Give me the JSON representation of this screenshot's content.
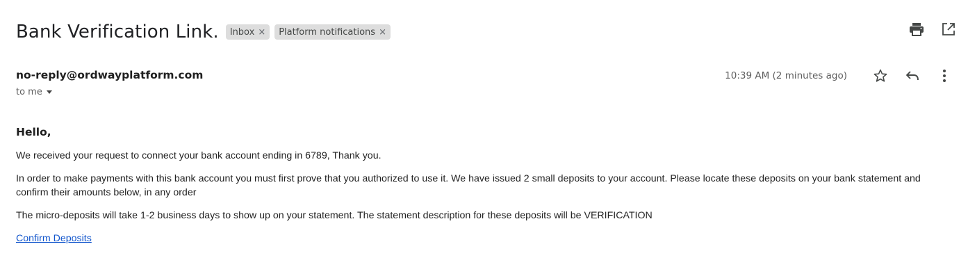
{
  "email": {
    "subject": "Bank Verification Link.",
    "labels": [
      {
        "name": "Inbox",
        "remove": "×"
      },
      {
        "name": "Platform notifications",
        "remove": "×"
      }
    ],
    "sender": "no-reply@ordwayplatform.com",
    "recipient": "to me",
    "timestamp": "10:39 AM (2 minutes ago)"
  },
  "icons": {
    "print": "print-icon",
    "open_new_window": "open-in-new-window-icon",
    "star": "star-icon",
    "reply": "reply-icon",
    "more": "more-vertical-icon",
    "recipient_caret": "caret-down-icon"
  },
  "body": {
    "greeting": "Hello,",
    "paragraphs": [
      "We received your request to connect your bank account ending in 6789, Thank you.",
      "In order to make payments with this bank account you must first prove that you authorized to use it. We have issued 2 small deposits to your account. Please locate these deposits on your bank statement and confirm their amounts below, in any order",
      "The micro-deposits will take 1-2 business days to show up on your statement. The statement description for these deposits will be VERIFICATION"
    ],
    "link_text": "Confirm Deposits"
  },
  "colors": {
    "link": "#1155cc",
    "chip_bg": "#dddddd",
    "text": "#202124",
    "muted": "#5e5e5e"
  }
}
